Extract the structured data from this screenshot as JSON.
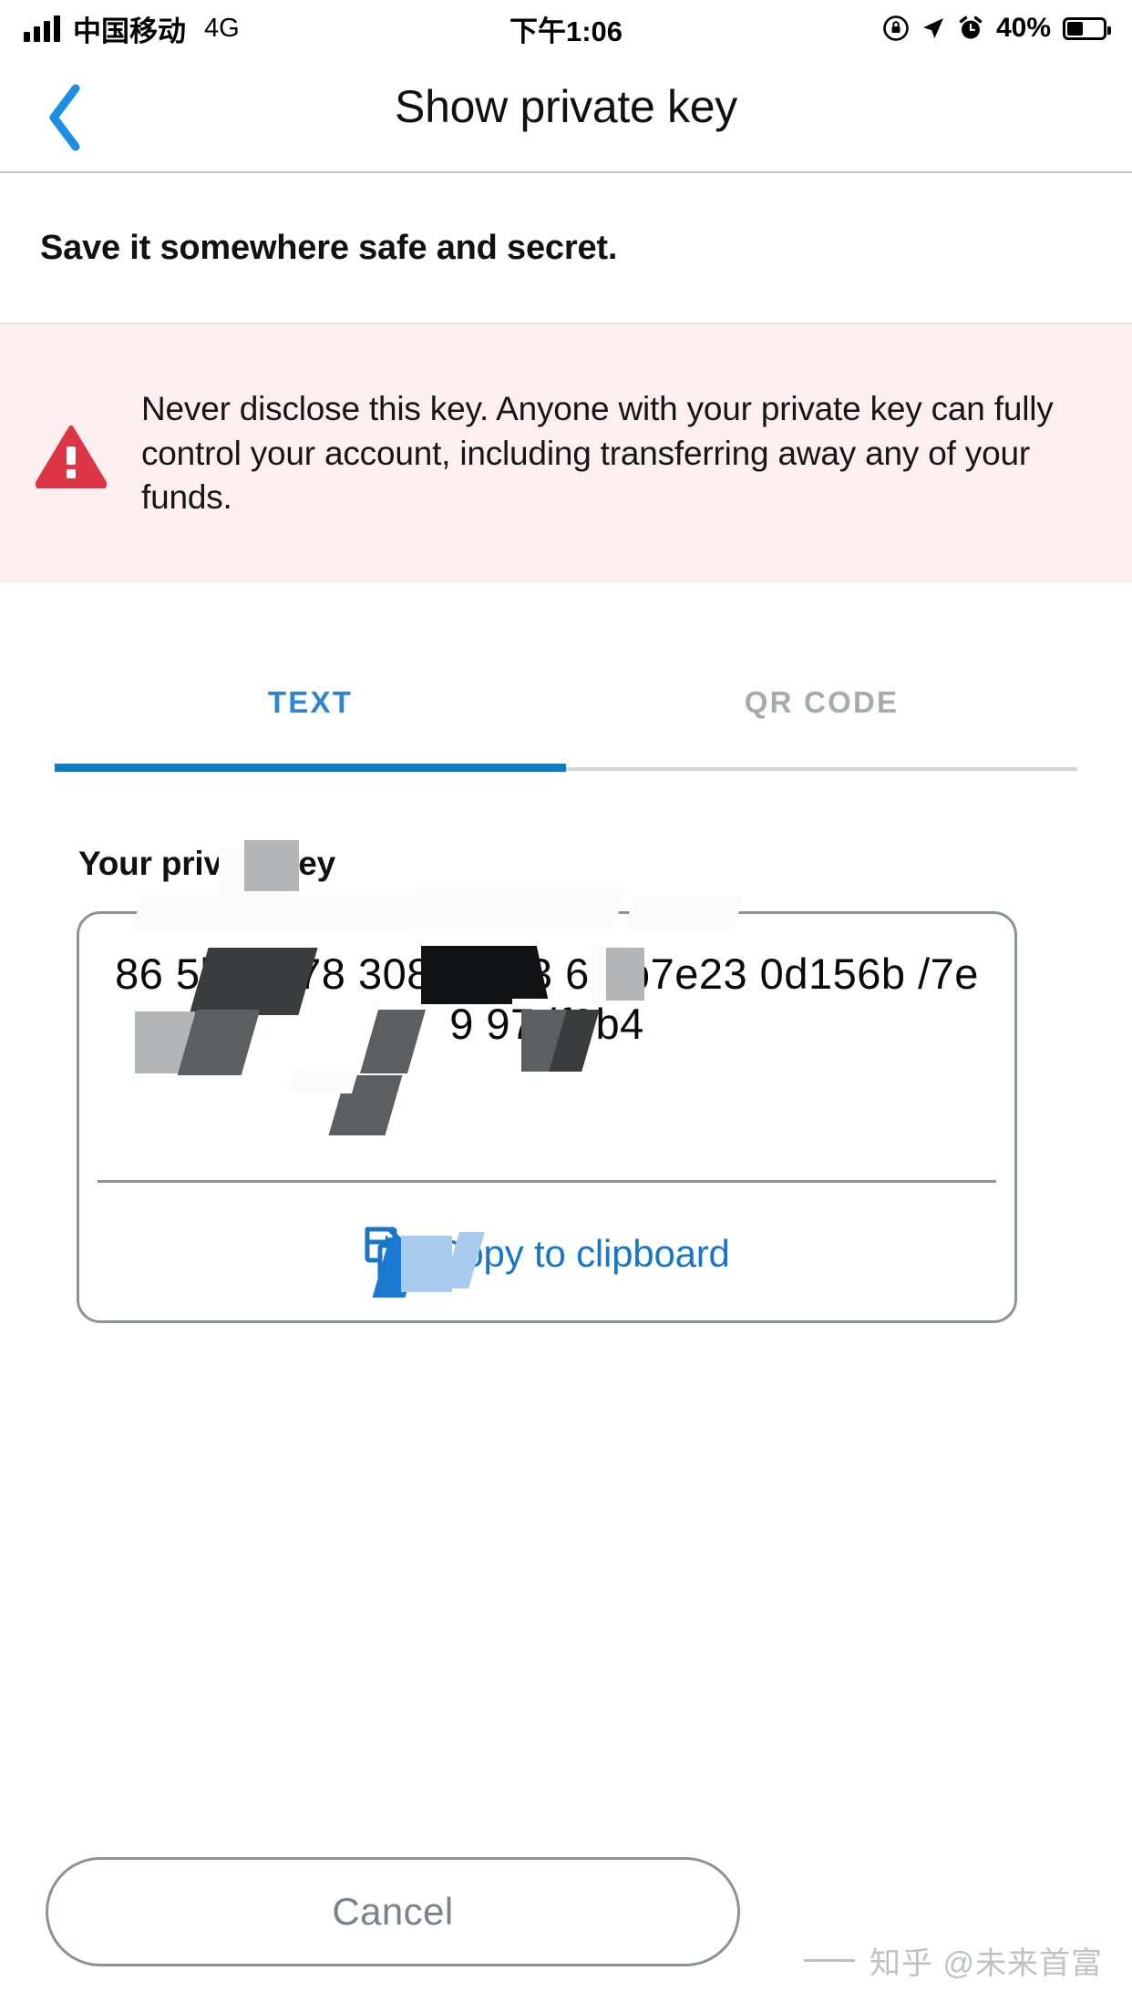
{
  "status_bar": {
    "carrier": "中国移动",
    "network": "4G",
    "time": "下午1:06",
    "battery_percent": "40%",
    "icons": [
      "signal-bars-icon",
      "rotation-lock-icon",
      "location-arrow-icon",
      "alarm-clock-icon",
      "battery-icon"
    ]
  },
  "nav": {
    "back_icon": "chevron-left-icon",
    "title": "Show private key"
  },
  "subtitle": "Save it somewhere safe and secret.",
  "warning": {
    "icon": "warning-triangle-icon",
    "text": "Never disclose this key. Anyone with your private key can fully control your account, including transferring away any of your funds.",
    "background_color": "#fdeef0",
    "icon_color": "#dc3545"
  },
  "tabs": [
    {
      "label": "TEXT",
      "active": true,
      "color": "#2e86d1"
    },
    {
      "label": "QR CODE",
      "active": false,
      "color": "#a9aaac"
    }
  ],
  "tab_indicator_color": "#0e7cc4",
  "key_section": {
    "label": "Your private key",
    "value": "86      5b81878   308218     /3  6    5b7e23   0d156b   /7e9  97df9b4",
    "copy_icon": "copy-icon",
    "copy_label": "Copy to clipboard",
    "copy_color": "#1776c6",
    "redacted": true
  },
  "cancel_button": {
    "label": "Cancel",
    "color": "#7c8289"
  },
  "watermark": "知乎 @未来首富"
}
